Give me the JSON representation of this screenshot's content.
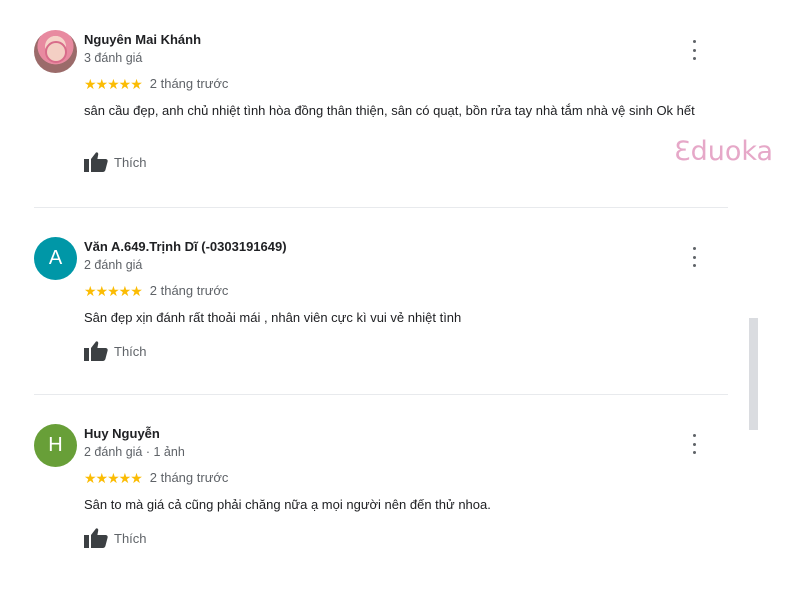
{
  "watermark": "Ɛduoka",
  "like_label": "Thích",
  "reviews": [
    {
      "name": "Nguyên Mai Khánh",
      "meta": "3 đánh giá",
      "stars": "★★★★★",
      "rating": 5,
      "date": "2 tháng trước",
      "text": "sân cầu đẹp, anh chủ nhiệt tình hòa đồng thân thiện, sân có quạt, bồn rửa tay nhà tắm nhà vệ sinh Ok hết",
      "avatar_letter": "",
      "avatar_color": ""
    },
    {
      "name": "Văn A.649.Trịnh Dĩ (-0303191649)",
      "meta": "2 đánh giá",
      "stars": "★★★★★",
      "rating": 5,
      "date": "2 tháng trước",
      "text": "Sân đẹp xịn đánh rất thoải mái , nhân viên cực kì vui vẻ nhiệt tình",
      "avatar_letter": "A",
      "avatar_color": "#0097a7"
    },
    {
      "name": "Huy Nguyễn",
      "meta": "2 đánh giá · 1 ảnh",
      "stars": "★★★★★",
      "rating": 5,
      "date": "2 tháng trước",
      "text": "Sân to mà giá cả cũng phải chăng nữa ạ mọi người nên đến thử nhoa.",
      "avatar_letter": "H",
      "avatar_color": "#689f38"
    }
  ],
  "colors": {
    "star": "#fbbc04",
    "watermark": "#e6a8c8",
    "text": "#202124",
    "secondary": "#5f6368"
  }
}
